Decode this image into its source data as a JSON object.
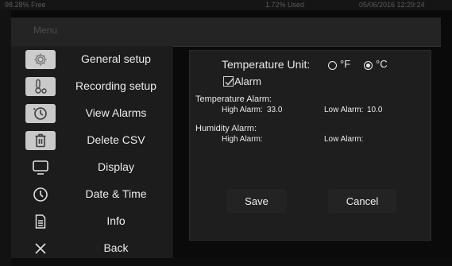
{
  "statusbar": {
    "free": "98.28% Free",
    "used": "1.72% Used",
    "datetime": "05/06/2016 12:29:24"
  },
  "menu_title": "Menu",
  "sidebar": {
    "items": [
      {
        "label": "General setup",
        "icon": "gear-icon"
      },
      {
        "label": "Recording setup",
        "icon": "probe-icon"
      },
      {
        "label": "View Alarms",
        "icon": "clock-icon"
      },
      {
        "label": "Delete CSV",
        "icon": "trash-icon"
      },
      {
        "label": "Display",
        "icon": "monitor-icon"
      },
      {
        "label": "Date & Time",
        "icon": "clock-icon"
      },
      {
        "label": "Info",
        "icon": "document-icon"
      },
      {
        "label": "Back",
        "icon": "close-icon"
      }
    ]
  },
  "settings": {
    "temp_unit_label": "Temperature Unit:",
    "unit_f": "°F",
    "unit_c": "°C",
    "selected_unit": "°C",
    "alarm_label": "Alarm",
    "alarm_checked": true,
    "temp_alarm_label": "Temperature Alarm:",
    "temp_high_label": "High Alarm:",
    "temp_high_value": "33.0",
    "temp_low_label": "Low Alarm:",
    "temp_low_value": "10.0",
    "hum_alarm_label": "Humidity Alarm:",
    "hum_high_label": "High Alarm:",
    "hum_low_label": "Low Alarm:",
    "save_label": "Save",
    "cancel_label": "Cancel"
  },
  "colors": {
    "background": "#0a0a0a",
    "sidebar": "#1c1c1c",
    "panel": "#1e1e1e",
    "active_icon": "#cdcdcd"
  }
}
